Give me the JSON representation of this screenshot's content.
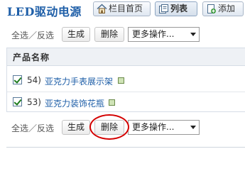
{
  "page": {
    "title": "LED驱动电源"
  },
  "toolbar": {
    "home_label": "栏目首页",
    "list_label": "列表",
    "add_label": "添加"
  },
  "top_actions": {
    "select_label": "全选／反选",
    "generate_label": "生成",
    "delete_label": "删除",
    "more_label": "更多操作..."
  },
  "table": {
    "header": "产品名称",
    "rows": [
      {
        "index": "54)",
        "name": "亚克力手表展示架",
        "checked": true
      },
      {
        "index": "53)",
        "name": "亚克力装饰花瓶",
        "checked": true
      }
    ]
  },
  "bottom_actions": {
    "select_label": "全选／反选",
    "generate_label": "生成",
    "delete_label": "删除",
    "more_label": "更多操作..."
  },
  "colors": {
    "title": "#1f5fa8",
    "link": "#1f5fa8",
    "highlight_circle": "#d40000"
  }
}
